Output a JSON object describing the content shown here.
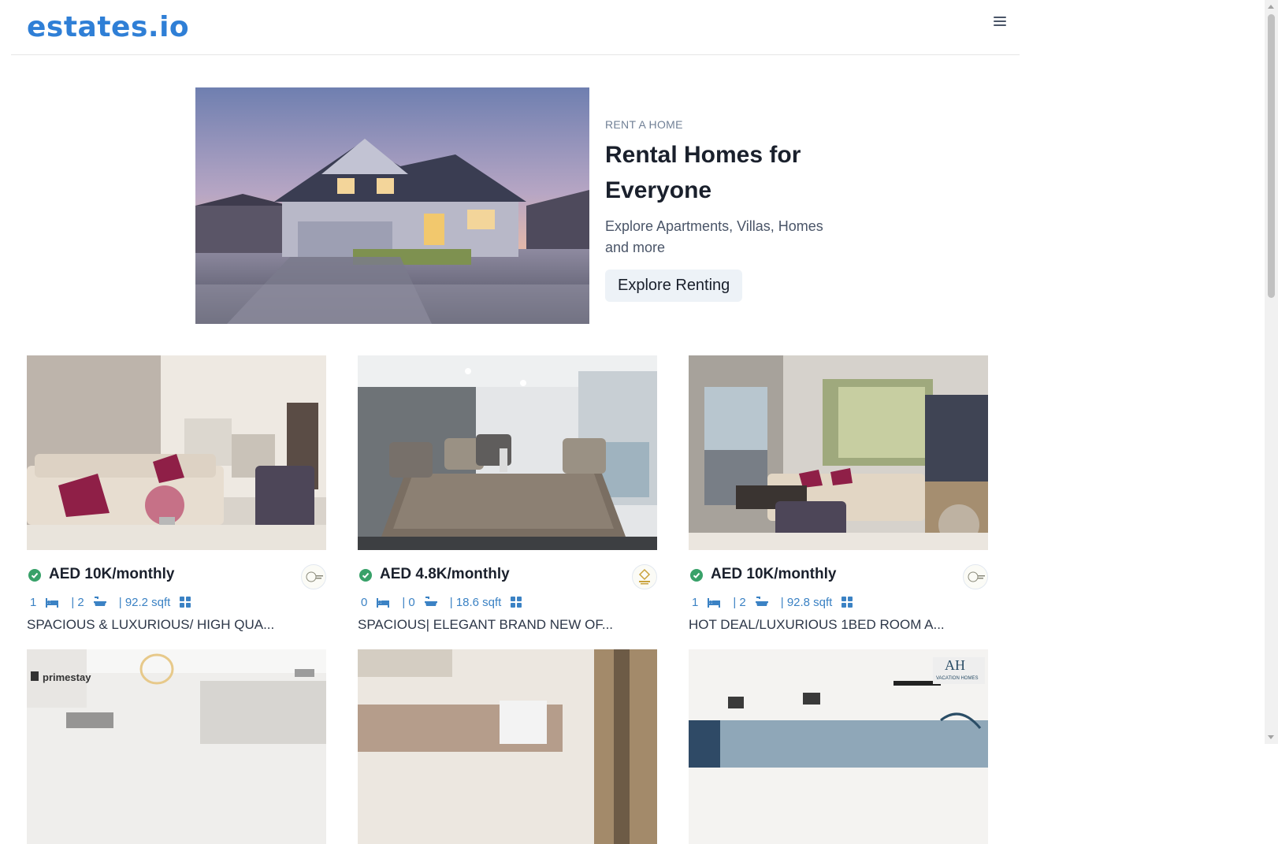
{
  "nav": {
    "logo": "estates.io",
    "menu_icon": "hamburger-menu-icon"
  },
  "hero": {
    "eyebrow": "RENT A HOME",
    "title": "Rental Homes for Everyone",
    "subtitle": "Explore Apartments, Villas, Homes and more",
    "button": "Explore Renting"
  },
  "listings": [
    {
      "price": "AED 10K/monthly",
      "rooms": "1",
      "baths": "| 2",
      "area": "| 92.2 sqft",
      "title": "SPACIOUS & LUXURIOUS/ HIGH QUA...",
      "agent_logo": "agency-logo-beige"
    },
    {
      "price": "AED 4.8K/monthly",
      "rooms": "0",
      "baths": "| 0",
      "area": "| 18.6 sqft",
      "title": "SPACIOUS| ELEGANT BRAND NEW OF...",
      "agent_logo": "agency-logo-gold"
    },
    {
      "price": "AED 10K/monthly",
      "rooms": "1",
      "baths": "| 2",
      "area": "| 92.8 sqft",
      "title": "HOT DEAL/LUXURIOUS 1BED ROOM A...",
      "agent_logo": "agency-logo-beige"
    }
  ],
  "listing_photo_labels": {
    "primestay": "primestay",
    "vacation": "AH",
    "vacation_sub": "VACATION HOMES"
  },
  "colors": {
    "brand": "#2f7fd6",
    "accent": "#3b82c4",
    "verified": "#38a169"
  }
}
